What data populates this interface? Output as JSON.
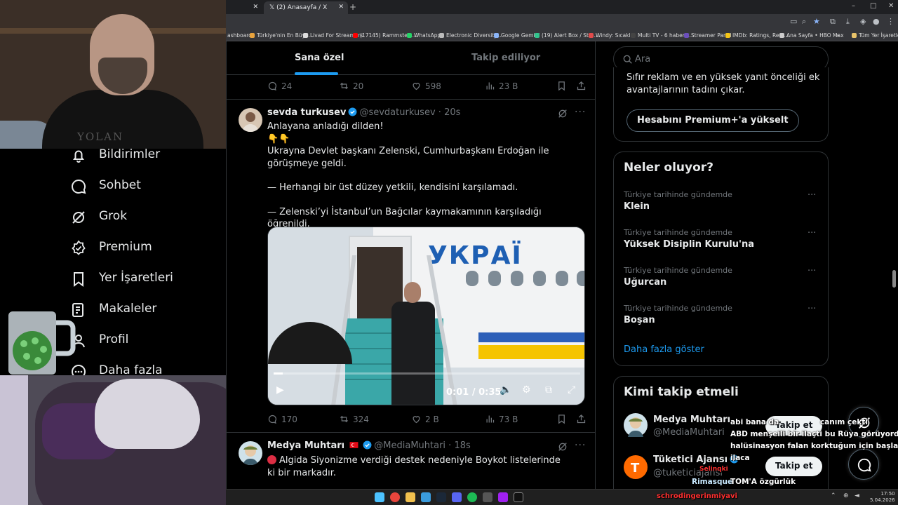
{
  "browser": {
    "tab_active_title": "(2) Anasayfa / X",
    "bookmarks": [
      "ashboard",
      "Türkiye'nin En Büyü...",
      "Livad For Streamers",
      "(17145) Rammstein...",
      "WhatsApp",
      "Electronic Diversity...",
      "Google Gemini",
      "(19) Alert Box / Stre...",
      "Windy: Sıcaklık",
      "Multi TV - 6 haber k...",
      "Streamer Panel",
      "IMDb: Ratings, Revi...",
      "Ana Sayfa • HBO Max",
      "»",
      "Tüm Yer İşaretleri"
    ]
  },
  "sidebar": {
    "items": [
      {
        "label": "Bildirimler",
        "icon": "bell-icon"
      },
      {
        "label": "Sohbet",
        "icon": "chat-icon"
      },
      {
        "label": "Grok",
        "icon": "grok-icon"
      },
      {
        "label": "Premium",
        "icon": "premium-icon"
      },
      {
        "label": "Yer İşaretleri",
        "icon": "bookmark-icon"
      },
      {
        "label": "Makaleler",
        "icon": "article-icon"
      },
      {
        "label": "Profil",
        "icon": "person-icon"
      },
      {
        "label": "Daha fazla",
        "icon": "more-circle-icon"
      }
    ]
  },
  "feed": {
    "tabs": [
      "Sana özel",
      "Takip ediliyor"
    ],
    "prev_tweet_stats": {
      "replies": "24",
      "reposts": "20",
      "likes": "598",
      "views": "23 B"
    },
    "tweet1": {
      "name": "sevda turkusev",
      "handle": "@sevdaturkusev",
      "time": "20s",
      "line1": "Anlayana anladığı dilden!",
      "emoji": "👇👇",
      "line2": "Ukrayna Devlet başkanı Zelenski, Cumhurbaşkanı Erdoğan ile görüşmeye geldi.",
      "line3": "— Herhangi bir üst düzey yetkili, kendisini karşılamadı.",
      "line4": "— Zelenski’yi İstanbul’un Bağcılar kaymakamının karşıladığı öğrenildi.",
      "video": {
        "plane_text": "УКРАЇ",
        "time": "0:01 / 0:35",
        "progress": 0.03
      },
      "stats": {
        "replies": "170",
        "reposts": "324",
        "likes": "2 B",
        "views": "73 B"
      }
    },
    "tweet2": {
      "name": "Medya Muhtarı",
      "handle": "@MediaMuhtari",
      "time": "18s",
      "text": "Algida Siyonizme verdiği destek nedeniyle Boykot listelerinde ki bir markadır."
    }
  },
  "right": {
    "search_placeholder": "Ara",
    "premium_text": "Sıfır reklam ve en yüksek yanıt önceliği ek avantajlarının tadını çıkar.",
    "premium_button": "Hesabını Premium+'a yükselt",
    "trends_title": "Neler oluyor?",
    "trends": [
      {
        "category": "Türkiye tarihinde gündemde",
        "name": "Klein"
      },
      {
        "category": "Türkiye tarihinde gündemde",
        "name": "Yüksek Disiplin Kurulu'na"
      },
      {
        "category": "Türkiye tarihinde gündemde",
        "name": "Uğurcan"
      },
      {
        "category": "Türkiye tarihinde gündemde",
        "name": "Boşan"
      }
    ],
    "show_more": "Daha fazla göster",
    "who_title": "Kimi takip etmeli",
    "who": [
      {
        "name": "Medya Muhtarı",
        "handle": "@MediaMuhtari",
        "button": "Takip et"
      },
      {
        "name": "Tüketici Ajansı",
        "handle": "@tuketiciajansi",
        "button": "Takip et"
      }
    ]
  },
  "chat_overlay": {
    "lines": [
      "abi bana da",
      "canım çekti",
      "ABD menşeili bir ilaçti bu Rüya görüyordu",
      "halüsinasyon falan korktuğum için başlamadım",
      "ilaca",
      "Selinqki",
      "Rimasque",
      "TOM'A özgürlük",
      "schrodingerinmiyavi"
    ]
  },
  "clock": {
    "time": "17:50",
    "date": "5.04.2026"
  },
  "colors": {
    "accent": "#1d9bf0",
    "background": "#000000",
    "border": "#2f3336",
    "muted": "#71767b"
  }
}
